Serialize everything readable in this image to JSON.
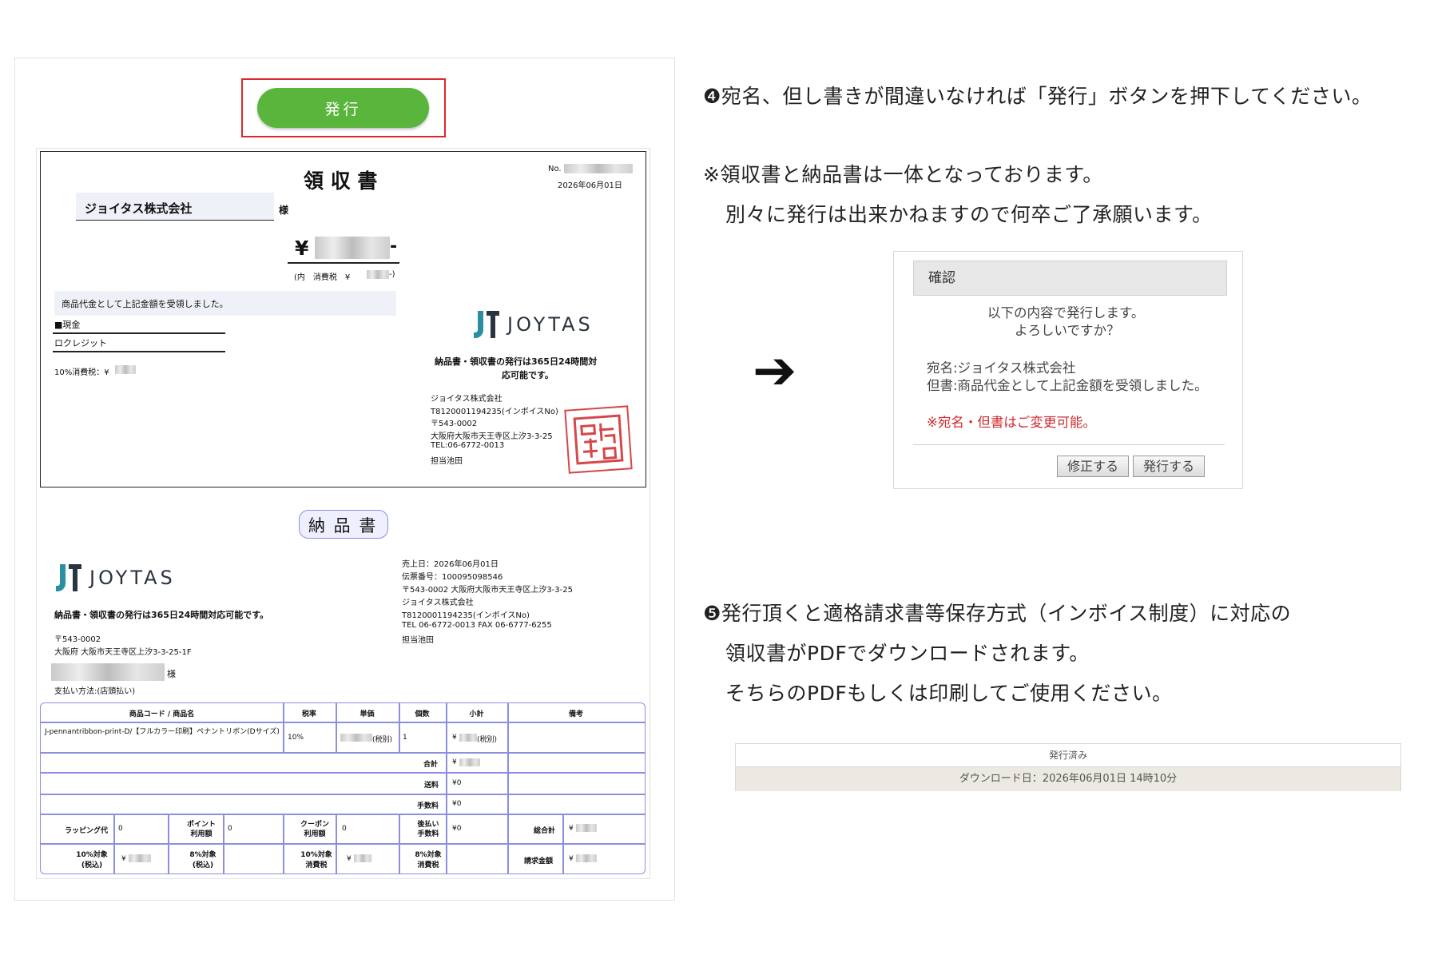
{
  "issue_button": "発行",
  "receipt": {
    "title": "領 収 書",
    "no_label": "No.",
    "date": "2026年06月01日",
    "addressee": "ジョイタス株式会社",
    "honorific": "様",
    "amount_prefix": "¥",
    "amount_suffix": "-",
    "tax_note_prefix": "(内　消費税　¥",
    "tax_note_suffix": "-)",
    "proviso": "商品代金として上記金額を受領しました。",
    "payment_cash": "■現金",
    "payment_credit": "ロクレジット",
    "tax10": "10%消費税：¥",
    "notice": [
      "納品書・領収書の発行は365日24時間対",
      "応可能です。"
    ],
    "issuer_lines": [
      "ジョイタス株式会社",
      "T8120001194235(インボイスNo)",
      "〒543-0002",
      "大阪府大阪市天王寺区上汐3-3-25",
      "TEL:06-6772-0013",
      "担当池田"
    ],
    "stamp_text": "印"
  },
  "logo_text": "JOYTAS",
  "delivery": {
    "title": "納 品 書",
    "notice": "納品書・領収書の発行は365日24時間対応可能です。",
    "customer_address": [
      "〒543-0002",
      "大阪府 大阪市天王寺区上汐3-3-25-1F"
    ],
    "honorific": "様",
    "payment_method": "支払い方法:(店頭払い)",
    "info_lines": [
      "売上日：2026年06月01日",
      "伝票番号：100095098546",
      "〒543-0002 大阪府大阪市天王寺区上汐3-3-25",
      "ジョイタス株式会社",
      "T8120001194235(インボイスNo)",
      "TEL 06-6772-0013 FAX 06-6777-6255",
      "担当池田"
    ],
    "table": {
      "headers": [
        "商品コード / 商品名",
        "税率",
        "単価",
        "個数",
        "小計",
        "備考"
      ],
      "item_name": "J-pennantribbon-print-D/【フルカラー印刷】ペナントリボン(Dサイズ)",
      "item_tax": "10%",
      "item_price_suffix": "(税別)",
      "item_qty": "1",
      "item_subtotal_prefix": "¥",
      "item_subtotal_suffix": "(税別)",
      "total_label": "合計",
      "total_value": "¥",
      "shipping_label": "送料",
      "shipping_value": "¥0",
      "fee_label": "手数料",
      "fee_value": "¥0",
      "wrapping_label": "ラッピング代",
      "wrapping_value": "0",
      "points_label": [
        "ポイント",
        "利用額"
      ],
      "points_value": "0",
      "coupon_label": [
        "クーポン",
        "利用額"
      ],
      "coupon_value": "0",
      "later_label": [
        "後払い",
        "手数料"
      ],
      "later_value": "¥0",
      "grand_label": "総合計",
      "grand_value": "¥",
      "t10_label": [
        "10%対象",
        "(税込)"
      ],
      "t10_value": "¥",
      "t8_label": [
        "8%対象",
        "(税込)"
      ],
      "tax10_label": [
        "10%対象",
        "消費税"
      ],
      "tax10_value": "¥",
      "tax8_label": [
        "8%対象",
        "消費税"
      ],
      "invoice_label": "請求金額",
      "invoice_value": "¥"
    }
  },
  "instructions": {
    "step4": "❹宛名、但し書きが間違いなければ「発行」ボタンを押下してください。",
    "note_line1": "※領収書と納品書は一体となっております。",
    "note_line2": "別々に発行は出来かねますので何卒ご了承願います。",
    "arrow": "➔",
    "step5_line1": "❺発行頂くと適格請求書等保存方式（インボイス制度）に対応の",
    "step5_line2": "領収書がPDFでダウンロードされます。",
    "step5_line3": "そちらのPDFもしくは印刷してご使用ください。"
  },
  "dialog": {
    "title": "確認",
    "line1": "以下の内容で発行します。",
    "line2": "よろしいですか？",
    "addressee": "宛名:ジョイタス株式会社",
    "proviso": "但書:商品代金として上記金額を受領しました。",
    "warning": "※宛名・但書はご変更可能。",
    "edit_button": "修正する",
    "issue_button": "発行する"
  },
  "download": {
    "status": "発行済み",
    "date": "ダウンロード日：2026年06月01日 14時10分"
  },
  "colors": {
    "issue_green": "#5ab53c",
    "highlight_red": "#e0262b",
    "table_border": "#8d8ee0",
    "logo_teal": "#2a8fa0",
    "warning_red": "#d0282c"
  }
}
